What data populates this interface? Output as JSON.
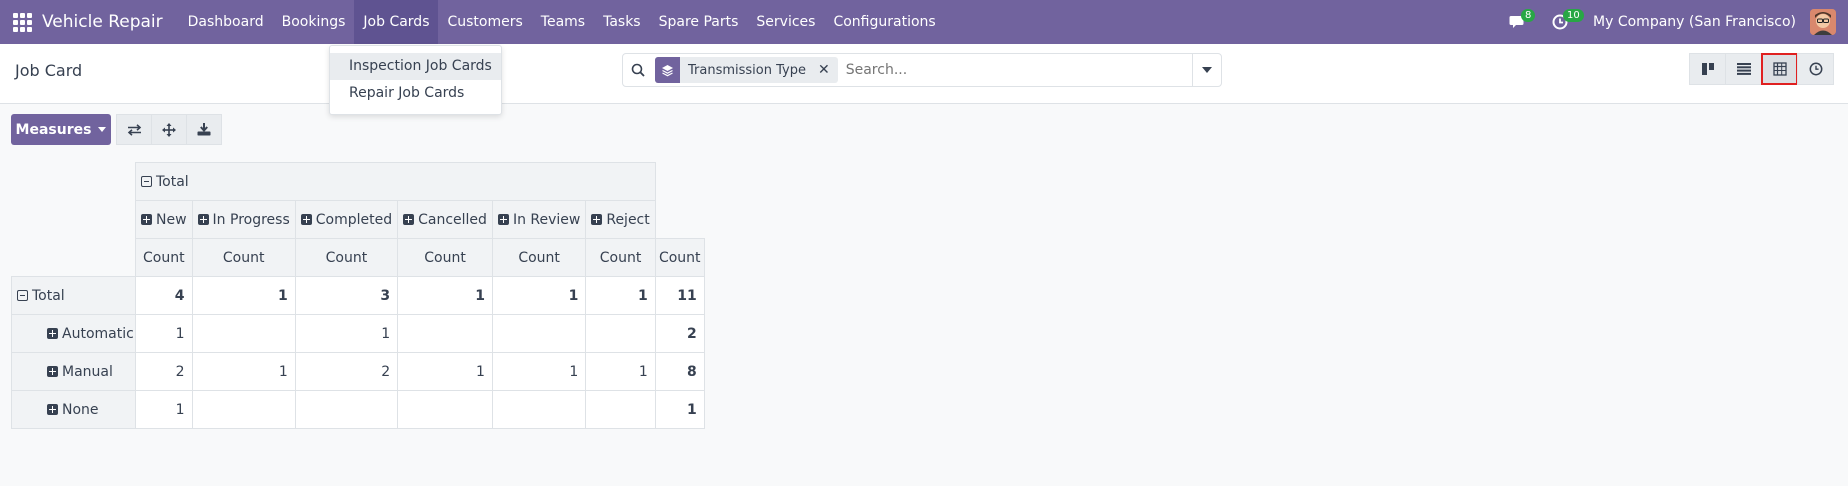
{
  "nav": {
    "app_name": "Vehicle Repair",
    "menu": [
      "Dashboard",
      "Bookings",
      "Job Cards",
      "Customers",
      "Teams",
      "Tasks",
      "Spare Parts",
      "Services",
      "Configurations"
    ],
    "messages_count": "8",
    "activities_count": "10",
    "company": "My Company (San Francisco)"
  },
  "control": {
    "title": "Job Card",
    "facet_label": "Transmission Type",
    "search_placeholder": "Search..."
  },
  "dropdown": {
    "items": [
      "Inspection Job Cards",
      "Repair Job Cards"
    ]
  },
  "toolbar": {
    "measures_label": "Measures"
  },
  "pivot": {
    "col_group": "Total",
    "columns": [
      "New",
      "In Progress",
      "Completed",
      "Cancelled",
      "In Review",
      "Reject"
    ],
    "measure": "Count",
    "rows": [
      {
        "label": "Total",
        "values": [
          "4",
          "1",
          "3",
          "1",
          "1",
          "1"
        ],
        "total": "11"
      },
      {
        "label": "Automatic",
        "values": [
          "1",
          "",
          "1",
          "",
          "",
          ""
        ],
        "total": "2"
      },
      {
        "label": "Manual",
        "values": [
          "2",
          "1",
          "2",
          "1",
          "1",
          "1"
        ],
        "total": "8"
      },
      {
        "label": "None",
        "values": [
          "1",
          "",
          "",
          "",
          "",
          ""
        ],
        "total": "1"
      }
    ]
  },
  "colors": {
    "brand": "#71639e",
    "badge": "#28a745",
    "highlight_border": "#e02020"
  }
}
